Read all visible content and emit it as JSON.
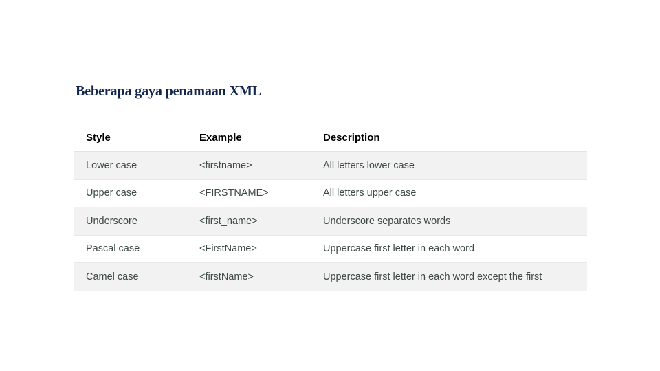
{
  "slide": {
    "title": "Beberapa gaya penamaan XML",
    "title_color": "#12264d",
    "background_color": "#ffffff"
  },
  "table": {
    "stripe_color": "#f2f2f2",
    "border_color": "#d9d9d9",
    "columns": [
      {
        "key": "style",
        "label": "Style"
      },
      {
        "key": "example",
        "label": "Example"
      },
      {
        "key": "description",
        "label": "Description"
      }
    ],
    "rows": [
      {
        "style": "Lower case",
        "example": "<firstname>",
        "description": "All letters lower case"
      },
      {
        "style": "Upper case",
        "example": "<FIRSTNAME>",
        "description": "All letters upper case"
      },
      {
        "style": "Underscore",
        "example": "<first_name>",
        "description": "Underscore separates words"
      },
      {
        "style": "Pascal case",
        "example": "<FirstName>",
        "description": "Uppercase first letter in each word"
      },
      {
        "style": "Camel case",
        "example": "<firstName>",
        "description": "Uppercase first letter in each word except the first"
      }
    ]
  }
}
